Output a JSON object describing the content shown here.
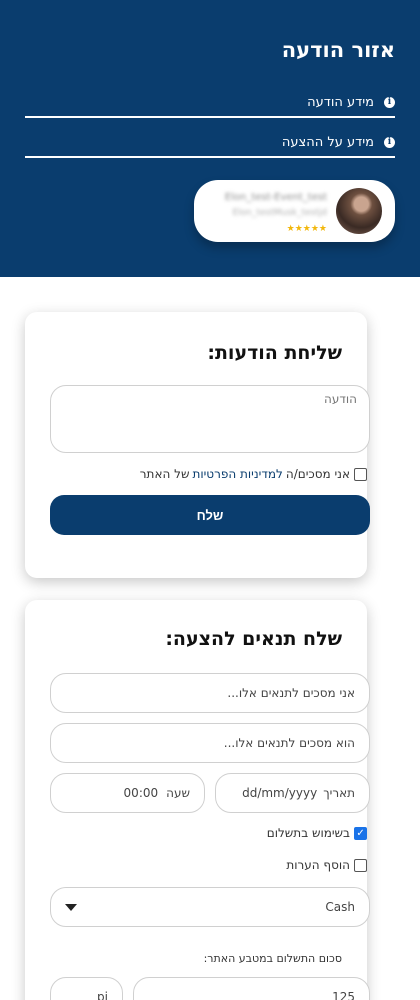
{
  "header": {
    "title": "אזור הודעה",
    "info_rows": [
      {
        "label": "מידע הודעה"
      },
      {
        "label": "מידע על ההצעה"
      }
    ],
    "profile": {
      "name": "Elon_test-Event_test",
      "subtitle": "Elon_testMusk_testjd",
      "stars": "★★★★★"
    },
    "colors": {
      "header_bg": "#0a3d6e",
      "stars": "#f2b70c"
    }
  },
  "messages_card": {
    "title": "שליחת הודעות:",
    "message_placeholder": "הודעה",
    "consent_prefix": "אני מסכים/ה",
    "privacy_link": "למדיניות הפרטיות",
    "consent_suffix": "של האתר",
    "consent_checked": false,
    "send_label": "שלח"
  },
  "offer_card": {
    "title": "שלח תנאים להצעה:",
    "field1_value": "אני מסכים לתנאים אלו...",
    "field2_value": "הוא מסכים לתנאים אלו...",
    "date_label": "תאריך",
    "date_value": "dd/mm/yyyy",
    "time_label": "שעה",
    "time_value": "00:00",
    "use_payment_label": "בשימוש בתשלום",
    "use_payment_checked": true,
    "add_notes_label": "הוסף הערות",
    "add_notes_checked": false,
    "payment_method": "Cash",
    "amount_label": "סכום התשלום במטבע האתר:",
    "amount_value": "125",
    "currency_value": "pi"
  }
}
